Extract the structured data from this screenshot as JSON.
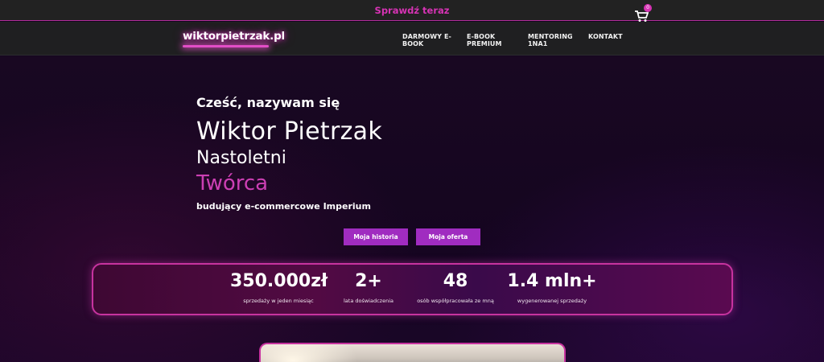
{
  "topbar": {
    "cta": "Sprawdź teraz"
  },
  "header": {
    "logo": "wiktorpietrzak.pl",
    "nav": [
      "DARMOWY E-BOOK",
      "E-BOOK PREMIUM",
      "MENTORING 1NA1",
      "KONTAKT"
    ],
    "cart_count": "0"
  },
  "hero": {
    "greeting": "Cześć, nazywam się",
    "name": "Wiktor Pietrzak",
    "line1": "Nastoletni",
    "line2": "Twórca",
    "line3": "budujący e-commercowe Imperium",
    "buttons": [
      "Moja historia",
      "Moja oferta"
    ]
  },
  "stats": [
    {
      "value": "350.000zł",
      "label": "sprzedaży w jeden miesiąc"
    },
    {
      "value": "2+",
      "label": "lata doświadczenia"
    },
    {
      "value": "48",
      "label": "osób współpracowała ze mną"
    },
    {
      "value": "1.4 mln+",
      "label": "wygenerowanej sprzedaży"
    }
  ],
  "colors": {
    "accent": "#d633b4",
    "button": "#a02cc0",
    "background": "#14061f"
  }
}
